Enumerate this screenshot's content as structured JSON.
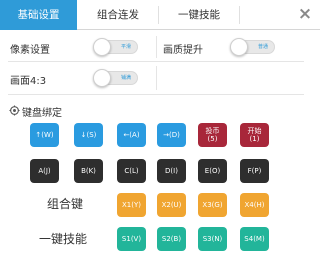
{
  "tabs": [
    {
      "label": "基础设置",
      "active": true
    },
    {
      "label": "组合连发",
      "active": false
    },
    {
      "label": "一键技能",
      "active": false
    }
  ],
  "close_glyph": "×",
  "settings": {
    "pixel": {
      "label": "像素设置",
      "toggle_text": "平滑"
    },
    "quality": {
      "label": "画质提升",
      "toggle_text": "普通"
    },
    "ratio": {
      "label": "画面4:3",
      "toggle_text": "铺满"
    }
  },
  "keyboard_binding": {
    "title": "键盘绑定",
    "icon": "settings-gear-icon"
  },
  "keys_row1": [
    {
      "label": "↑(W)",
      "color": "blue"
    },
    {
      "label": "↓(S)",
      "color": "blue"
    },
    {
      "label": "←(A)",
      "color": "blue"
    },
    {
      "label": "→(D)",
      "color": "blue"
    },
    {
      "label_top": "投币",
      "label_bottom": "(5)",
      "color": "red"
    },
    {
      "label_top": "开始",
      "label_bottom": "(1)",
      "color": "red"
    }
  ],
  "keys_row2": [
    "A(J)",
    "B(K)",
    "C(L)",
    "D(I)",
    "E(O)",
    "F(P)"
  ],
  "combo": {
    "label": "组合键",
    "keys": [
      "X1(Y)",
      "X2(U)",
      "X3(G)",
      "X4(H)"
    ]
  },
  "skill": {
    "label": "一键技能",
    "keys": [
      "S1(V)",
      "S2(B)",
      "S3(N)",
      "S4(M)"
    ]
  },
  "colors": {
    "blue": "#2a9be0",
    "red": "#a8273a",
    "dark": "#2e2e2e",
    "orange": "#f0a531",
    "teal": "#22b59a",
    "active_tab": "#2f9bd8"
  }
}
